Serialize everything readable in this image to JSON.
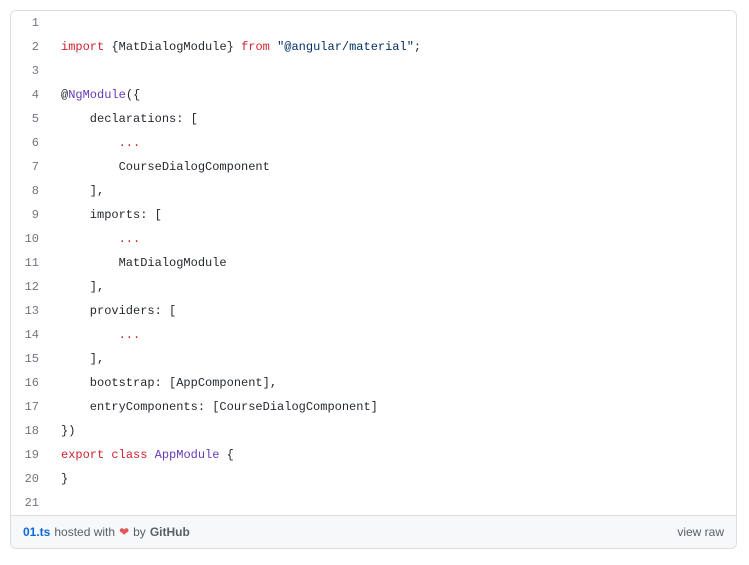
{
  "code": {
    "lines": [
      {
        "num": "1",
        "tokens": []
      },
      {
        "num": "2",
        "tokens": [
          {
            "t": "import",
            "c": "kw-import"
          },
          {
            "t": " {",
            "c": "punct"
          },
          {
            "t": "MatDialogModule",
            "c": "plain"
          },
          {
            "t": "} ",
            "c": "punct"
          },
          {
            "t": "from",
            "c": "kw-from"
          },
          {
            "t": " ",
            "c": "plain"
          },
          {
            "t": "\"@angular/material\"",
            "c": "str"
          },
          {
            "t": ";",
            "c": "punct"
          }
        ]
      },
      {
        "num": "3",
        "tokens": []
      },
      {
        "num": "4",
        "tokens": [
          {
            "t": "@",
            "c": "punct"
          },
          {
            "t": "NgModule",
            "c": "decorator"
          },
          {
            "t": "({",
            "c": "punct"
          }
        ]
      },
      {
        "num": "5",
        "tokens": [
          {
            "t": "    declarations: [",
            "c": "plain"
          }
        ]
      },
      {
        "num": "6",
        "tokens": [
          {
            "t": "        ",
            "c": "plain"
          },
          {
            "t": "...",
            "c": "spread"
          }
        ]
      },
      {
        "num": "7",
        "tokens": [
          {
            "t": "        CourseDialogComponent",
            "c": "plain"
          }
        ]
      },
      {
        "num": "8",
        "tokens": [
          {
            "t": "    ],",
            "c": "plain"
          }
        ]
      },
      {
        "num": "9",
        "tokens": [
          {
            "t": "    imports: [",
            "c": "plain"
          }
        ]
      },
      {
        "num": "10",
        "tokens": [
          {
            "t": "        ",
            "c": "plain"
          },
          {
            "t": "...",
            "c": "spread"
          }
        ]
      },
      {
        "num": "11",
        "tokens": [
          {
            "t": "        MatDialogModule",
            "c": "plain"
          }
        ]
      },
      {
        "num": "12",
        "tokens": [
          {
            "t": "    ],",
            "c": "plain"
          }
        ]
      },
      {
        "num": "13",
        "tokens": [
          {
            "t": "    providers: [",
            "c": "plain"
          }
        ]
      },
      {
        "num": "14",
        "tokens": [
          {
            "t": "        ",
            "c": "plain"
          },
          {
            "t": "...",
            "c": "spread"
          }
        ]
      },
      {
        "num": "15",
        "tokens": [
          {
            "t": "    ],",
            "c": "plain"
          }
        ]
      },
      {
        "num": "16",
        "tokens": [
          {
            "t": "    bootstrap: [AppComponent],",
            "c": "plain"
          }
        ]
      },
      {
        "num": "17",
        "tokens": [
          {
            "t": "    entryComponents: [CourseDialogComponent]",
            "c": "plain"
          }
        ]
      },
      {
        "num": "18",
        "tokens": [
          {
            "t": "})",
            "c": "punct"
          }
        ]
      },
      {
        "num": "19",
        "tokens": [
          {
            "t": "export",
            "c": "kw-export"
          },
          {
            "t": " ",
            "c": "plain"
          },
          {
            "t": "class",
            "c": "kw-class"
          },
          {
            "t": " ",
            "c": "plain"
          },
          {
            "t": "AppModule",
            "c": "classname"
          },
          {
            "t": " {",
            "c": "punct"
          }
        ]
      },
      {
        "num": "20",
        "tokens": [
          {
            "t": "}",
            "c": "punct"
          }
        ]
      },
      {
        "num": "21",
        "tokens": []
      }
    ]
  },
  "footer": {
    "filename": "01.ts",
    "hosted_text": " hosted with ",
    "heart": "❤",
    "by_text": " by ",
    "github": "GitHub",
    "view_raw": "view raw"
  }
}
